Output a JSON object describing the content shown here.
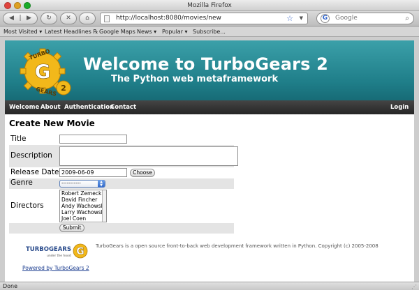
{
  "window": {
    "title": "Mozilla Firefox"
  },
  "toolbar": {
    "back_icon": "back-arrow-icon",
    "forward_icon": "forward-arrow-icon",
    "reload_icon": "reload-icon",
    "stop_icon": "stop-icon",
    "home_icon": "home-icon",
    "url": "http://localhost:8080/movies/new",
    "search_placeholder": "Google"
  },
  "bookmarks": [
    "Most Visited ▾",
    "Latest Headlines ℞",
    "Google Maps",
    "News ▾",
    "Popular ▾",
    "Subscribe..."
  ],
  "banner": {
    "title": "Welcome to TurboGears 2",
    "tagline": "The Python web metaframework",
    "logo_top": "TURBO",
    "logo_bottom": "GEARS",
    "logo_letter": "G",
    "logo_version": "2",
    "colors": {
      "gear": "#f2b81a",
      "banner": "#2a8f99"
    }
  },
  "menu": {
    "items": [
      "Welcome",
      "About",
      "Authentication",
      "Contact"
    ],
    "login": "Login"
  },
  "form": {
    "title": "Create New Movie",
    "labels": {
      "title": "Title",
      "description": "Description",
      "release_date": "Release Date",
      "genre": "Genre",
      "directors": "Directors"
    },
    "release_date_value": "2009-06-09",
    "choose_label": "Choose",
    "genre_selected": "-----------",
    "directors_options": [
      "Robert Zemeckis",
      "David Fincher",
      "Andy Wachowski",
      "Larry Wachowski",
      "Joel Coen"
    ],
    "submit_label": "Submit"
  },
  "footer": {
    "logo_text": "TURBOGEARS",
    "logo_subtitle": "under the hood",
    "logo_letter": "G",
    "text": "TurboGears is a open source front-to-back web development framework written in Python. Copyright (c) 2005-2008",
    "powered_link": "Powered by TurboGears 2"
  },
  "status": {
    "text": "Done"
  }
}
